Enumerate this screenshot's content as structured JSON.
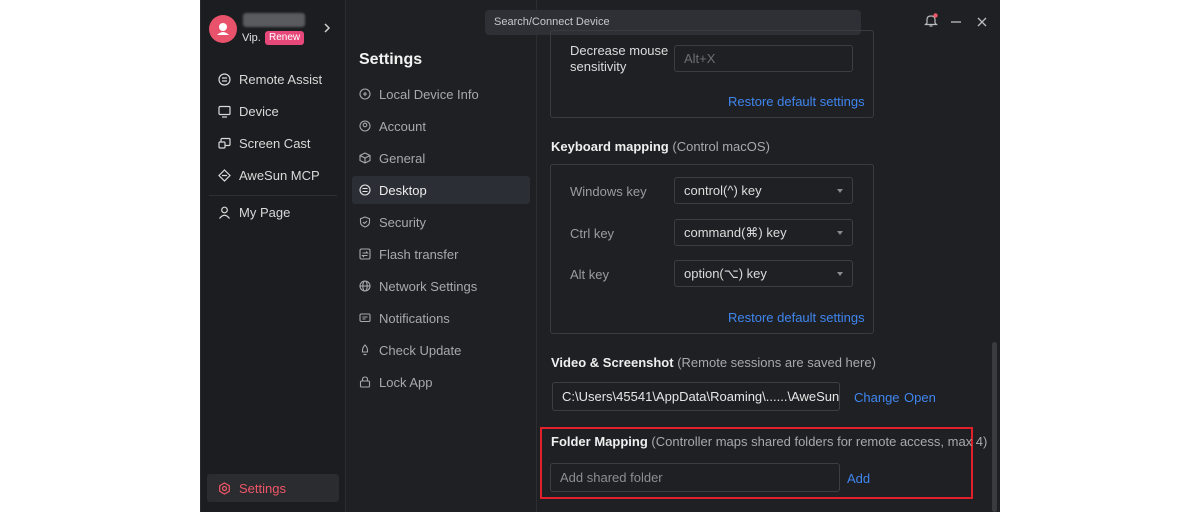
{
  "sidebar": {
    "vip_label": "Vip.",
    "renew_label": "Renew",
    "items": [
      {
        "label": "Remote Assist",
        "icon": "remote-assist-icon"
      },
      {
        "label": "Device",
        "icon": "monitor-icon"
      },
      {
        "label": "Screen Cast",
        "icon": "screen-cast-icon"
      },
      {
        "label": "AweSun MCP",
        "icon": "mcp-icon"
      },
      {
        "label": "My Page",
        "icon": "user-icon"
      }
    ],
    "settings_label": "Settings"
  },
  "settings_menu": {
    "title": "Settings",
    "items": [
      {
        "label": "Local Device Info"
      },
      {
        "label": "Account"
      },
      {
        "label": "General"
      },
      {
        "label": "Desktop"
      },
      {
        "label": "Security"
      },
      {
        "label": "Flash transfer"
      },
      {
        "label": "Network Settings"
      },
      {
        "label": "Notifications"
      },
      {
        "label": "Check Update"
      },
      {
        "label": "Lock App"
      }
    ],
    "active": "Desktop"
  },
  "topbar": {
    "search_label": "Search/Connect Device"
  },
  "content": {
    "mouse_panel": {
      "label": "Decrease mouse sensitivity",
      "shortcut_value": "Alt+X",
      "restore_label": "Restore default settings"
    },
    "keyboard_mapping": {
      "title": "Keyboard mapping",
      "note": "(Control macOS)",
      "rows": [
        {
          "key": "Windows key",
          "value": "control(^) key"
        },
        {
          "key": "Ctrl key",
          "value": "command(⌘) key"
        },
        {
          "key": "Alt key",
          "value": "option(⌥) key"
        }
      ],
      "restore_label": "Restore default settings"
    },
    "video": {
      "title": "Video & Screenshot",
      "note": "(Remote sessions are saved here)",
      "path": "C:\\Users\\45541\\AppData\\Roaming\\......\\AweSun",
      "change_label": "Change",
      "open_label": "Open"
    },
    "folder_mapping": {
      "title": "Folder Mapping",
      "note": "(Controller maps shared folders for remote access, max 4)",
      "placeholder": "Add shared folder",
      "add_label": "Add"
    }
  },
  "colors": {
    "accent": "#ef5667",
    "link": "#3f86f0",
    "highlight_border": "#e0202a",
    "renew_badge": "#e6487a"
  }
}
